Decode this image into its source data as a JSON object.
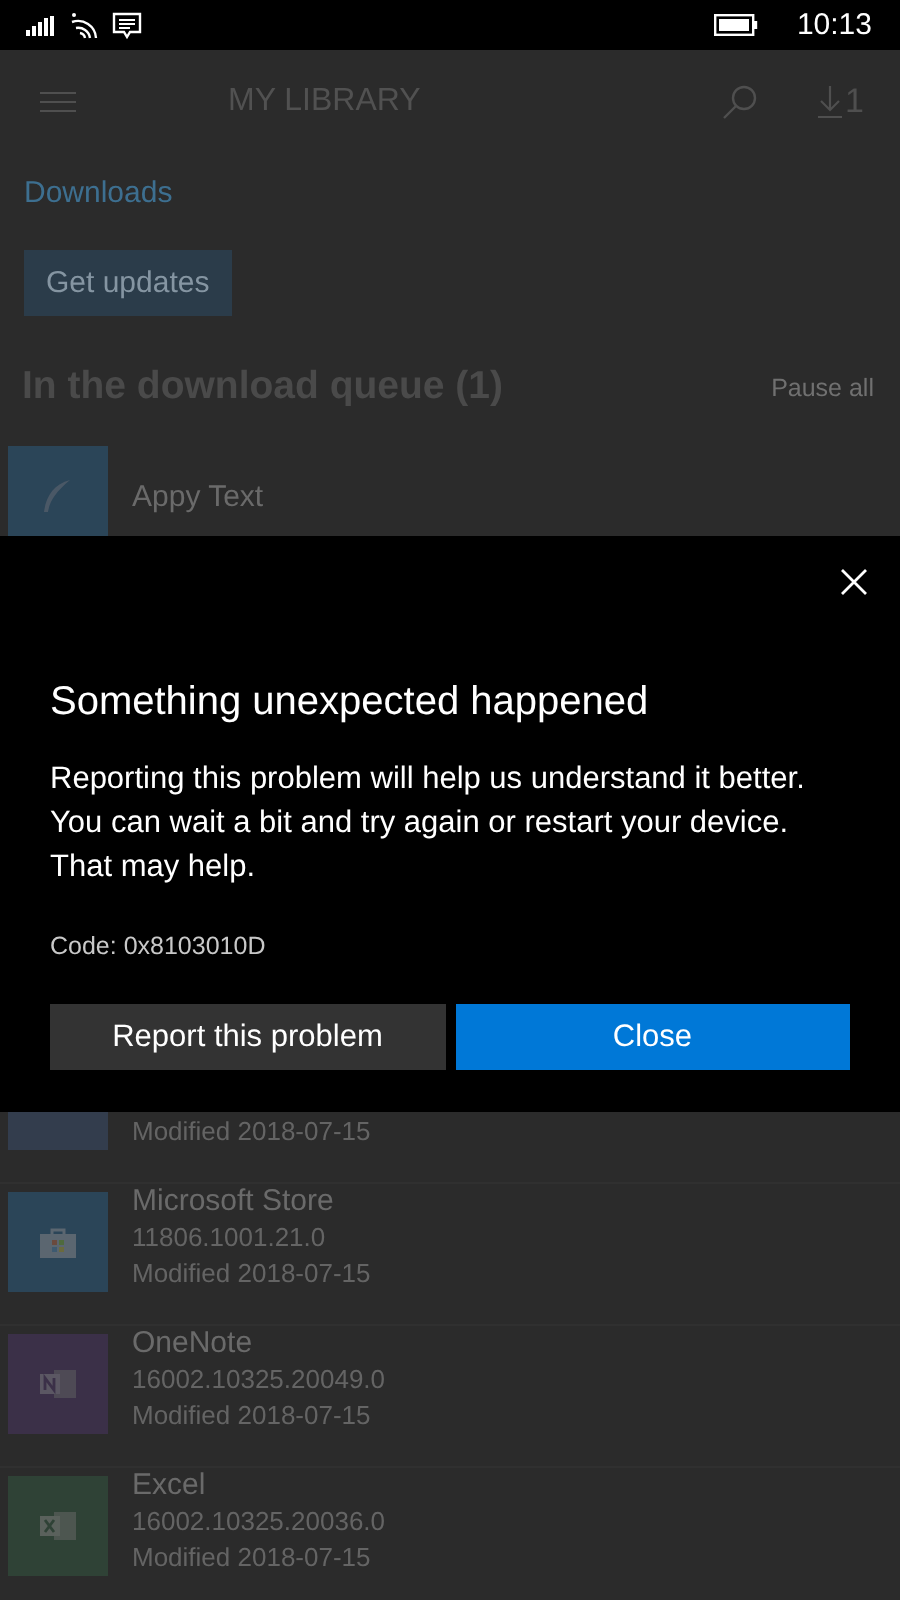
{
  "status_bar": {
    "time": "10:13"
  },
  "header": {
    "title": "MY LIBRARY",
    "download_count": "1"
  },
  "link": "Downloads",
  "update_button": "Get updates",
  "queue": {
    "heading": "In the download queue (1)",
    "pause_button": "Pause all",
    "items": [
      {
        "name": "Appy Text",
        "kind": "feather",
        "color": "#2b4558"
      }
    ]
  },
  "apps": [
    {
      "modified": "Modified 2018-07-15",
      "color": "#333d4d"
    },
    {
      "name": "Microsoft Store",
      "version": "11806.1001.21.0",
      "modified": "Modified 2018-07-15",
      "kind": "store",
      "color": "#2b4558"
    },
    {
      "name": "OneNote",
      "version": "16002.10325.20049.0",
      "modified": "Modified 2018-07-15",
      "kind": "onenote",
      "color": "#3b3048"
    },
    {
      "name": "Excel",
      "version": "16002.10325.20036.0",
      "modified": "Modified 2018-07-15",
      "kind": "excel",
      "color": "#2f4236"
    }
  ],
  "dialog": {
    "title": "Something unexpected happened",
    "message": "Reporting this problem will help us understand it better. You can wait a bit and try again or restart your device. That may help.",
    "code": "Code: 0x8103010D",
    "buttons": [
      {
        "label": "Report this problem",
        "primary": false
      },
      {
        "label": "Close",
        "primary": true
      }
    ]
  }
}
